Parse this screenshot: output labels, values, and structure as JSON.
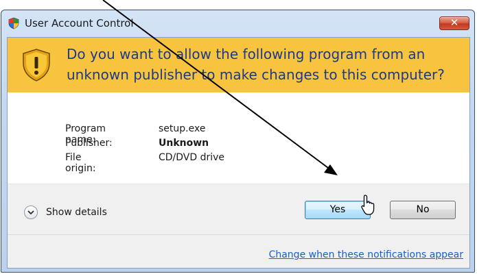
{
  "window": {
    "title": "User Account Control",
    "close_label": "✕"
  },
  "banner": {
    "question": "Do you want to allow the following program from an unknown publisher to make changes to this computer?",
    "color": "#f8c33f"
  },
  "details": [
    {
      "label": "Program name:",
      "value": "setup.exe",
      "bold": false
    },
    {
      "label": "Publisher:",
      "value": "Unknown",
      "bold": true
    },
    {
      "label": "File origin:",
      "value": "CD/DVD drive",
      "bold": false
    }
  ],
  "footer": {
    "show_details_label": "Show details",
    "yes_label": "Yes",
    "no_label": "No",
    "notification_link": "Change when these notifications appear"
  },
  "icons": {
    "title": "uac-shield-icon",
    "banner": "warning-shield-icon",
    "expander": "chevron-down-icon",
    "pointer": "mouse-pointer-icon",
    "annotation": "annotation-arrow"
  }
}
